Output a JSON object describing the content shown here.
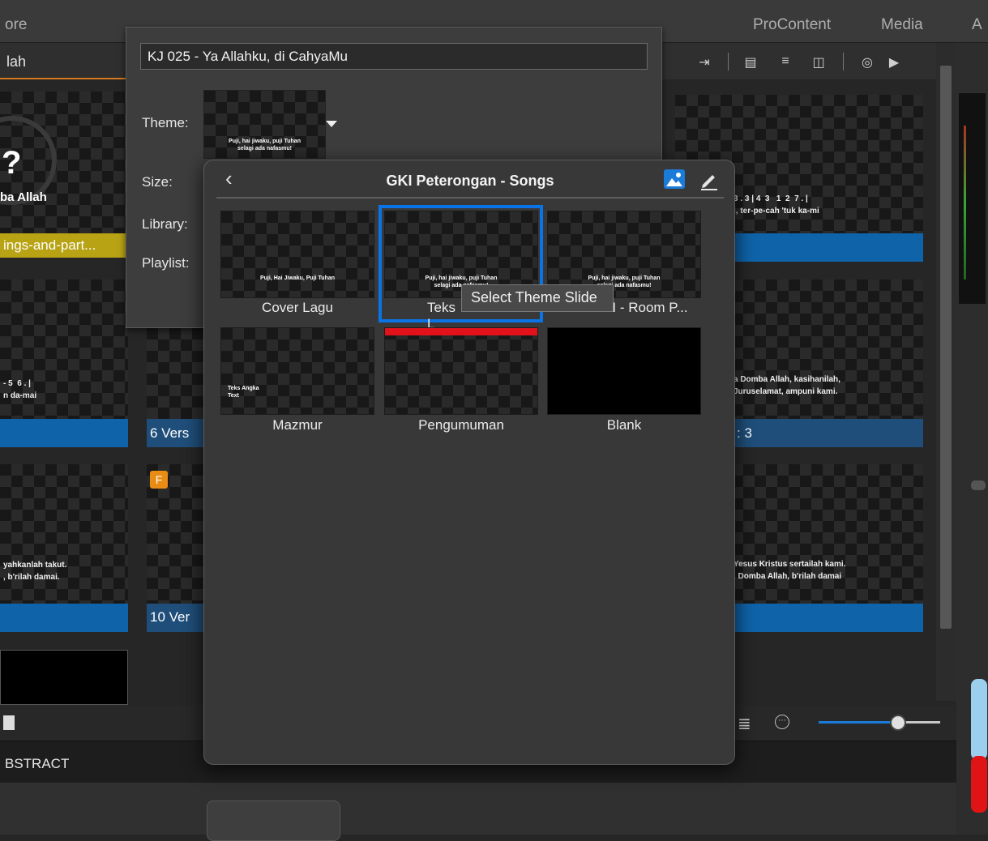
{
  "menubar": {
    "left_item": "ore",
    "items": [
      "ProContent",
      "Media",
      "A"
    ]
  },
  "left_panel": {
    "header_title": "lah",
    "tag_label": "ings-and-part...",
    "cover_title": "ba Allah",
    "slide_texts": {
      "s1": "- 5  6 . |\nn da-mai",
      "s2": "yahkanlah takut.\n, b'rilah damai."
    },
    "bottom_label": "BSTRACT"
  },
  "center_slides": {
    "label_6": "6  Vers",
    "label_10": "10  Ver",
    "f_badge": "F"
  },
  "right_slides": {
    "r1": "3 . 3 | 4  3   1  2  7 . |\ni, ter-pe-cah 'tuk ka-mi",
    "r2": "a Domba Allah, kasihanilah,\nJuruselamat, ampuni kami.",
    "r2_bar": ": 3",
    "r3": "Yesus Kristus sertailah kami.\n, Domba Allah, b'rilah damai"
  },
  "inspector": {
    "title_value": "KJ 025 - Ya Allahku, di CahyaMu",
    "labels": {
      "theme": "Theme:",
      "size": "Size:",
      "library": "Library:",
      "playlist": "Playlist:"
    },
    "theme_thumb_caption": "Puji, hai jiwaku, puji Tuhan\nselagi ada nafasmu!"
  },
  "popover": {
    "title": "GKI Peterongan - Songs",
    "back_icon": "chevron-left-icon",
    "image_icon": "image-icon",
    "edit_icon": "pencil-icon",
    "selected_color": "#0a74e6",
    "tiles": [
      {
        "label": "Cover Lagu",
        "caption": "Puji, Hai Jiwaku, Puji Tuhan"
      },
      {
        "label": "Teks L",
        "caption": "Puji, hai jiwaku, puji Tuhan\nselagi ada nafasmu!"
      },
      {
        "label": "I - Room P...",
        "caption": "Puji, hai jiwaku, puji Tuhan\nselagi ada nafasmu!"
      },
      {
        "label": "Mazmur",
        "caption": "Teks Angka\nText"
      },
      {
        "label": "Pengumuman",
        "caption": ""
      },
      {
        "label": "Blank",
        "caption": ""
      }
    ]
  },
  "tooltip": "Select Theme Slide",
  "zoom": {
    "fraction": 0.65
  }
}
